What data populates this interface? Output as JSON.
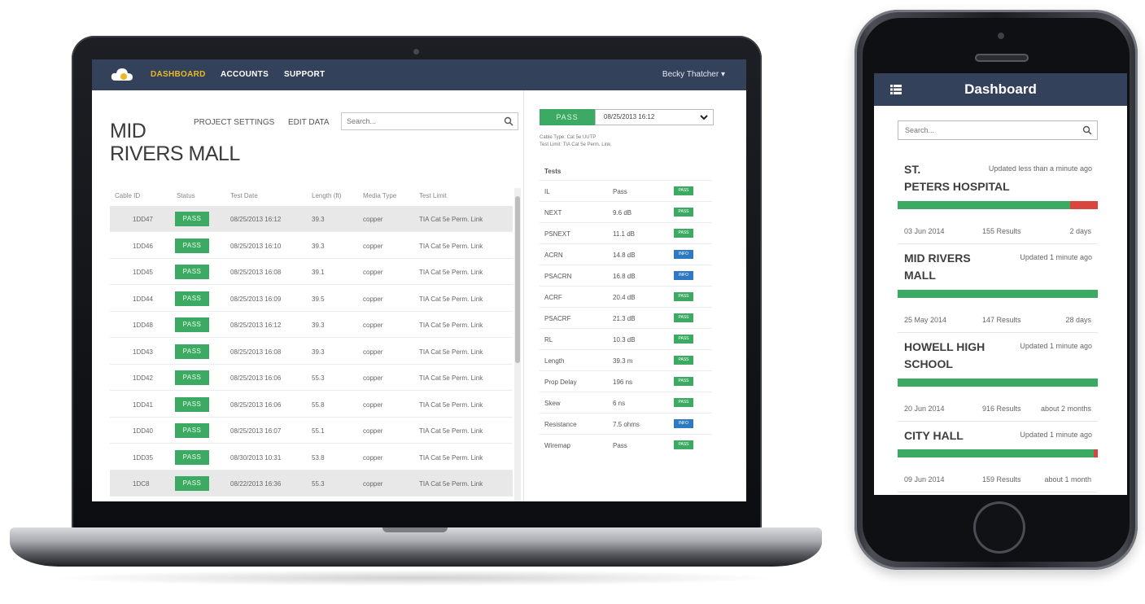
{
  "laptop": {
    "nav": {
      "items": [
        "DASHBOARD",
        "ACCOUNTS",
        "SUPPORT"
      ],
      "active": "DASHBOARD",
      "user": "Becky Thatcher ▾"
    },
    "project": {
      "title_line1": "MID",
      "title_line2": "RIVERS MALL",
      "settings_link": "PROJECT SETTINGS",
      "edit_link": "EDIT DATA",
      "search_placeholder": "Search..."
    },
    "table": {
      "headers": [
        "Cable ID",
        "Status",
        "Test Date",
        "Length (ft)",
        "Media Type",
        "Test Limit"
      ],
      "rows": [
        {
          "id": "1DD47",
          "status": "PASS",
          "date": "08/25/2013 16:12",
          "length": "39.3",
          "media": "copper",
          "limit": "TIA Cat 5e Perm. Link"
        },
        {
          "id": "1DD46",
          "status": "PASS",
          "date": "08/25/2013 16:10",
          "length": "39.3",
          "media": "copper",
          "limit": "TIA Cat 5e Perm. Link"
        },
        {
          "id": "1DD45",
          "status": "PASS",
          "date": "08/25/2013 16:08",
          "length": "39.1",
          "media": "copper",
          "limit": "TIA Cat 5e Perm. Link"
        },
        {
          "id": "1DD44",
          "status": "PASS",
          "date": "08/25/2013 16:09",
          "length": "39.5",
          "media": "copper",
          "limit": "TIA Cat 5e Perm. Link"
        },
        {
          "id": "1DD48",
          "status": "PASS",
          "date": "08/25/2013 16:12",
          "length": "39.3",
          "media": "copper",
          "limit": "TIA Cat 5e Perm. Link"
        },
        {
          "id": "1DD43",
          "status": "PASS",
          "date": "08/25/2013 16:08",
          "length": "39.3",
          "media": "copper",
          "limit": "TIA Cat 5e Perm. Link"
        },
        {
          "id": "1DD42",
          "status": "PASS",
          "date": "08/25/2013 16:06",
          "length": "55.3",
          "media": "copper",
          "limit": "TIA Cat 5e Perm. Link"
        },
        {
          "id": "1DD41",
          "status": "PASS",
          "date": "08/25/2013 16:06",
          "length": "55.8",
          "media": "copper",
          "limit": "TIA Cat 5e Perm. Link"
        },
        {
          "id": "1DD40",
          "status": "PASS",
          "date": "08/25/2013 16:07",
          "length": "55.1",
          "media": "copper",
          "limit": "TIA Cat 5e Perm. Link"
        },
        {
          "id": "1DD35",
          "status": "PASS",
          "date": "08/30/2013 10:31",
          "length": "53.8",
          "media": "copper",
          "limit": "TIA Cat 5e Perm. Link"
        },
        {
          "id": "1DC8",
          "status": "PASS",
          "date": "08/22/2013 16:36",
          "length": "55.3",
          "media": "copper",
          "limit": "TIA Cat 5e Perm. Link"
        }
      ]
    },
    "details": {
      "status": "PASS",
      "selected_date": "08/25/2013 16:12",
      "cable_type": "Cable Type: Cat 5e UUTP",
      "test_limit": "Test Limit: TIA Cat 5e Perm. Link",
      "tests_header": "Tests",
      "tests": [
        {
          "name": "IL",
          "value": "Pass",
          "badge": "PASS"
        },
        {
          "name": "NEXT",
          "value": "9.6 dB",
          "badge": "PASS"
        },
        {
          "name": "PSNEXT",
          "value": "11.1 dB",
          "badge": "PASS"
        },
        {
          "name": "ACRN",
          "value": "14.8 dB",
          "badge": "INFO"
        },
        {
          "name": "PSACRN",
          "value": "16.8 dB",
          "badge": "INFO"
        },
        {
          "name": "ACRF",
          "value": "20.4 dB",
          "badge": "PASS"
        },
        {
          "name": "PSACRF",
          "value": "21.3 dB",
          "badge": "PASS"
        },
        {
          "name": "RL",
          "value": "10.3 dB",
          "badge": "PASS"
        },
        {
          "name": "Length",
          "value": "39.3 m",
          "badge": "PASS"
        },
        {
          "name": "Prop Delay",
          "value": "196 ns",
          "badge": "PASS"
        },
        {
          "name": "Skew",
          "value": "6 ns",
          "badge": "PASS"
        },
        {
          "name": "Resistance",
          "value": "7.5 ohms",
          "badge": "INFO"
        },
        {
          "name": "Wiremap",
          "value": "Pass",
          "badge": "PASS"
        }
      ]
    }
  },
  "phone": {
    "title": "Dashboard",
    "search_placeholder": "Search...",
    "projects": [
      {
        "name_line1": "ST.",
        "name_line2": "PETERS HOSPITAL",
        "updated": "Updated less than a minute ago",
        "pass_fraction": 0.86,
        "date": "03 Jun 2014",
        "results": "155 Results",
        "age": "2 days"
      },
      {
        "name_line1": "MID RIVERS",
        "name_line2": "MALL",
        "updated": "Updated 1 minute ago",
        "pass_fraction": 1.0,
        "date": "25 May 2014",
        "results": "147 Results",
        "age": "28 days"
      },
      {
        "name_line1": "HOWELL HIGH",
        "name_line2": "SCHOOL",
        "updated": "Updated 1 minute ago",
        "pass_fraction": 1.0,
        "date": "20 Jun 2014",
        "results": "916 Results",
        "age": "about 2 months"
      },
      {
        "name_line1": "CITY HALL",
        "name_line2": "",
        "updated": "Updated 1 minute ago",
        "pass_fraction": 0.98,
        "date": "09 Jun 2014",
        "results": "159 Results",
        "age": "about 1 month"
      }
    ]
  },
  "colors": {
    "navbar": "#34415a",
    "active_nav": "#e8b928",
    "pass": "#3daa64",
    "info": "#2f79c3",
    "fail": "#d8463f"
  }
}
